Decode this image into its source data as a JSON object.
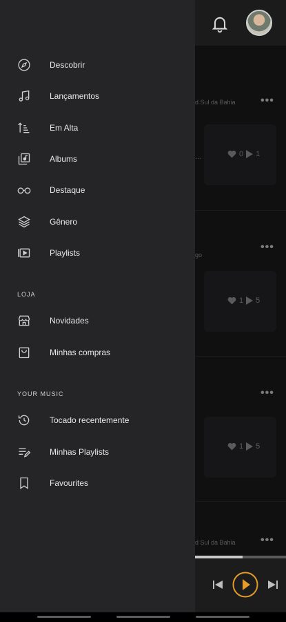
{
  "background": {
    "rows": [
      {
        "subtitle": "d Sul da Bahia",
        "likes": "0",
        "plays": "1",
        "snippet": "..."
      },
      {
        "subtitle": "go",
        "likes": "1",
        "plays": "5",
        "snippet": ""
      },
      {
        "subtitle": "",
        "likes": "1",
        "plays": "5",
        "snippet": ""
      },
      {
        "subtitle": "d Sul da Bahia",
        "likes": "",
        "plays": "",
        "snippet": ""
      }
    ],
    "more_label": "•••",
    "player": {
      "progress": 0.52
    }
  },
  "drawer": {
    "main_items": [
      {
        "label": "Descobrir",
        "icon": "compass-icon"
      },
      {
        "label": "Lançamentos",
        "icon": "music-note-icon"
      },
      {
        "label": "Em Alta",
        "icon": "trending-sort-icon"
      },
      {
        "label": "Albums",
        "icon": "album-library-icon"
      },
      {
        "label": "Destaque",
        "icon": "glasses-icon"
      },
      {
        "label": "Gênero",
        "icon": "layers-icon"
      },
      {
        "label": "Playlists",
        "icon": "playlist-video-icon"
      }
    ],
    "store_title": "LOJA",
    "store_items": [
      {
        "label": "Novidades",
        "icon": "store-icon"
      },
      {
        "label": "Minhas compras",
        "icon": "shopping-bag-icon"
      }
    ],
    "music_title": "YOUR MUSIC",
    "music_items": [
      {
        "label": "Tocado recentemente",
        "icon": "history-icon"
      },
      {
        "label": "Minhas Playlists",
        "icon": "playlist-edit-icon"
      },
      {
        "label": "Favourites",
        "icon": "bookmark-icon"
      }
    ]
  },
  "colors": {
    "accent": "#e39b2c",
    "drawer_bg": "#252527"
  }
}
